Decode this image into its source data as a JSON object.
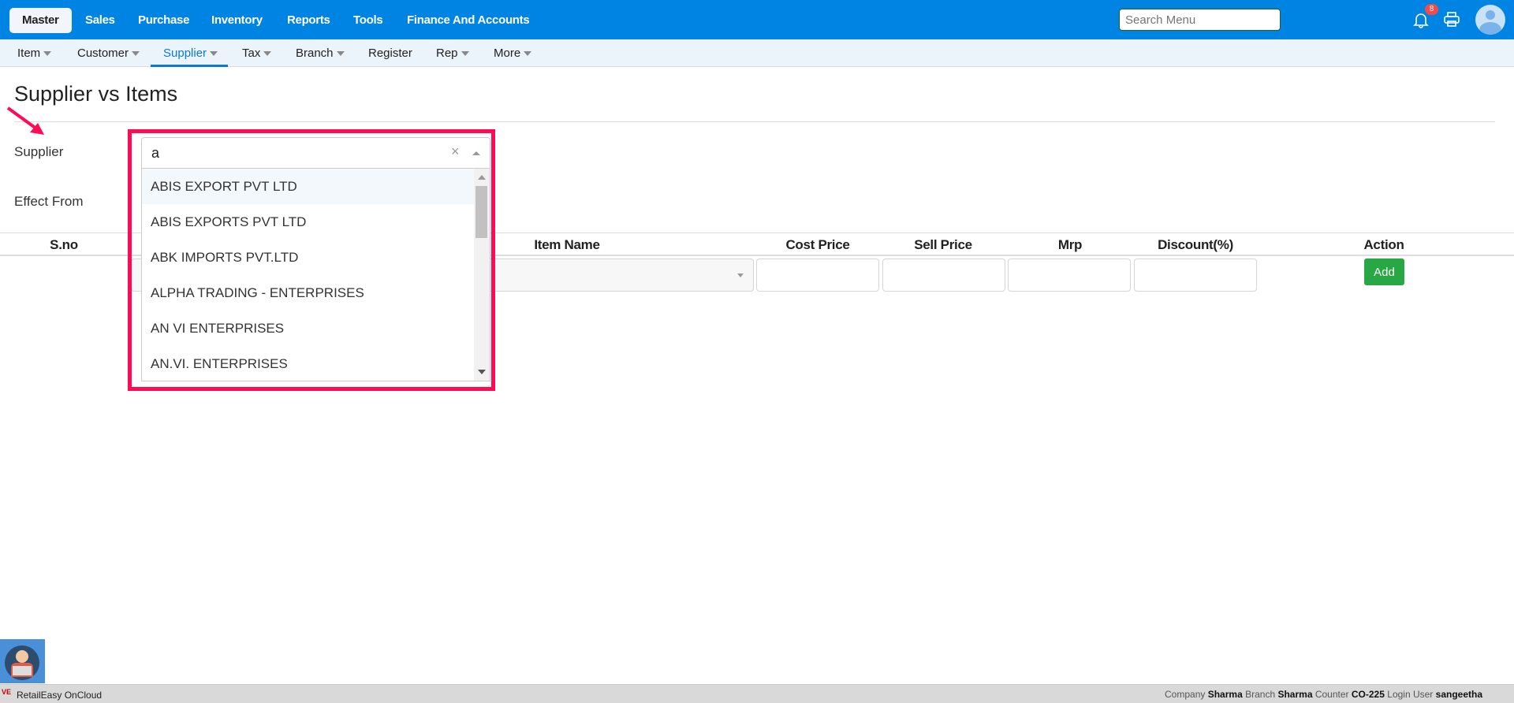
{
  "topnav": {
    "items": [
      "Master",
      "Sales",
      "Purchase",
      "Inventory",
      "Reports",
      "Tools",
      "Finance And Accounts"
    ],
    "active": "Master",
    "search_placeholder": "Search Menu",
    "notification_count": "8",
    "brand_color": "#0084e3"
  },
  "subnav": {
    "items": [
      "Item",
      "Customer",
      "Supplier",
      "Tax",
      "Branch",
      "Register",
      "Rep",
      "More"
    ],
    "active": "Supplier"
  },
  "page": {
    "title": "Supplier vs Items",
    "supplier_label": "Supplier",
    "effect_from_label": "Effect From"
  },
  "supplier_select": {
    "value": "a",
    "options": [
      "ABIS EXPORT PVT LTD",
      "ABIS EXPORTS PVT LTD",
      "ABK IMPORTS PVT.LTD",
      "ALPHA TRADING - ENTERPRISES",
      "AN VI ENTERPRISES",
      "AN.VI. ENTERPRISES"
    ],
    "highlighted": "ABIS EXPORT PVT LTD"
  },
  "table": {
    "headers": [
      "S.no",
      "Item Name",
      "Cost Price",
      "Sell Price",
      "Mrp",
      "Discount(%)",
      "Action"
    ],
    "add_label": "Add"
  },
  "footer": {
    "app_name": "RetailEasy OnCloud",
    "company_label": "Company",
    "company": "Sharma",
    "branch_label": "Branch",
    "branch": "Sharma",
    "counter_label": "Counter",
    "counter": "CO-225",
    "user_label": "Login User",
    "user": "sangeetha"
  }
}
